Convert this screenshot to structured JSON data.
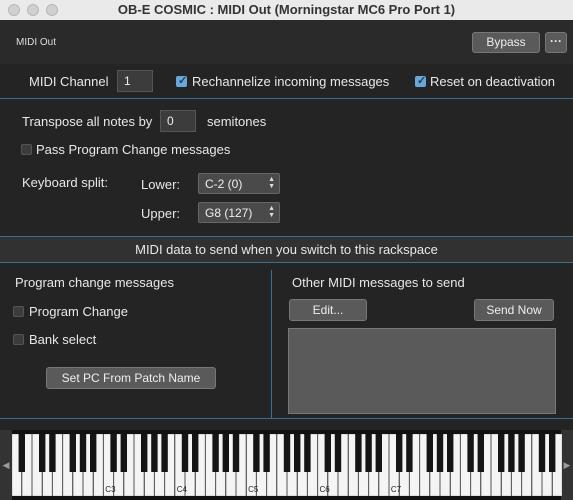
{
  "window": {
    "title": "OB-E COSMIC : MIDI Out (Morningstar MC6 Pro Port 1)"
  },
  "header": {
    "plugin_name": "MIDI Out",
    "bypass_label": "Bypass",
    "more_label": "···"
  },
  "channel_row": {
    "midi_channel_label": "MIDI Channel",
    "midi_channel_value": "1",
    "rechannelize_label": "Rechannelize incoming messages",
    "rechannelize_checked": true,
    "reset_label": "Reset on deactivation",
    "reset_checked": true
  },
  "transpose": {
    "prefix_label": "Transpose all notes by",
    "value": "0",
    "suffix_label": "semitones"
  },
  "pass_pc": {
    "label": "Pass Program Change messages",
    "checked": false
  },
  "split": {
    "label": "Keyboard split:",
    "lower_label": "Lower:",
    "lower_value": "C-2 (0)",
    "upper_label": "Upper:",
    "upper_value": "G8 (127)"
  },
  "send_section": {
    "banner": "MIDI data to send when you switch to this rackspace",
    "pc_heading": "Program change messages",
    "program_change_label": "Program Change",
    "program_change_checked": false,
    "bank_select_label": "Bank select",
    "bank_select_checked": false,
    "set_pc_button": "Set PC From Patch Name",
    "other_heading": "Other MIDI messages to send",
    "edit_button": "Edit...",
    "send_now_button": "Send Now"
  },
  "keyboard": {
    "octave_labels": [
      "C3",
      "C4",
      "C5",
      "C6",
      "C7"
    ],
    "left_arrow": "◀",
    "right_arrow": "▶"
  }
}
